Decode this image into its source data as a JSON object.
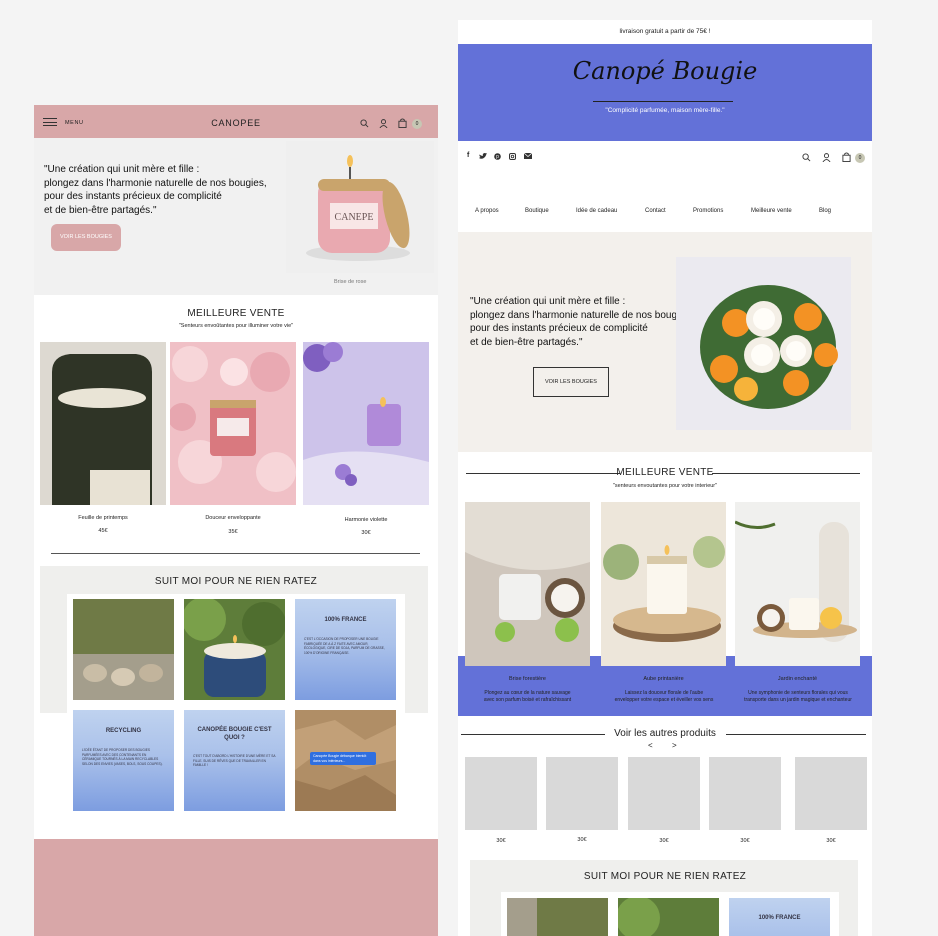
{
  "left": {
    "header": {
      "menu_label": "MENU",
      "brand": "CANOPEE",
      "cart_count": "0"
    },
    "hero": {
      "quote_lines": [
        "\"Une création qui unit mère et fille :",
        "plongez dans l'harmonie naturelle de nos bougies,",
        "pour des instants précieux de complicité",
        "et de bien-être partagés.\""
      ],
      "cta": "VOIR LES BOUGIES",
      "product_caption": "Brise de rose",
      "jar_label": "CANEPE"
    },
    "best": {
      "title": "MEILLEURE VENTE",
      "subtitle": "\"Senteurs envoûtantes pour illuminer votre vie\"",
      "products": [
        {
          "name": "Feuille de printemps",
          "price": "45€"
        },
        {
          "name": "Douceur enveloppante",
          "price": "35€"
        },
        {
          "name": "Harmonie violette",
          "price": "30€"
        }
      ]
    },
    "follow": {
      "title": "SUIT MOI POUR NE RIEN RATEZ",
      "cards": [
        {
          "title": "100% FRANCE",
          "body": "C'EST L'OCCASION DE PROPOSER UNE BOUGIE FABRIQUÉE DE A À Z FAITE AVEC AMOUR, ÉCOLOGIQUE, CIRE DE SOJA, PARFUM DE GRASSE, 100% D'ORIGINE FRANÇAISE."
        },
        {
          "title": "RECYCLING",
          "body": "L'IDÉE ÉTANT DE PROPOSER DES BOUGIES PARFUMÉES AVEC DES CONTENANTS EN CÉRAMIQUE TOURNÉS À LA MAIN RECYCLABLES SELON DES ENVIES (VASES, BOLS, SOUS COUPES)."
        },
        {
          "title": "CANOPÉE BOUGIE C'EST QUOI ?",
          "body": "C'EST TOUT D'ABORD L'HISTOIRE D'UNE MÈRE ET SA FILLE. SUIS DE RÊVES QUE DE TRAVAILLER EN FAMILLE !"
        }
      ],
      "message_bubble": "Canopée Bougie débarque bientôt dans vos intérieurs..."
    }
  },
  "right": {
    "topbar": "livraison gratuit a partir de 75€ !",
    "brand_script": "Canopé Bougie",
    "tagline": "\"Complicité parfumée, maison mère-fille.\"",
    "cart_count": "0",
    "nav": [
      "A propos",
      "Boutique",
      "Idée de cadeau",
      "Contact",
      "Promotions",
      "Meilleure vente",
      "Blog"
    ],
    "hero": {
      "quote_lines": [
        "\"Une création qui unit mère et fille :",
        "plongez dans l'harmonie naturelle de nos bougies,",
        "pour des instants précieux de complicité",
        "et de bien-être partagés.\""
      ],
      "cta": "VOIR LES BOUGIES"
    },
    "best": {
      "title": "MEILLEURE VENTE",
      "subtitle": "\"senteurs envoutantes pour votre interieur\"",
      "products": [
        {
          "name": "Brise forestière",
          "desc1": "Plongez au cœur de la nature sauvage",
          "desc2": "avec son parfum boisé et rafraîchissant"
        },
        {
          "name": "Aube printanière",
          "desc1": "Laissez la douceur florale de l'aube",
          "desc2": "envelopper votre espace et éveiller vos sens"
        },
        {
          "name": "Jardin enchanté",
          "desc1": "Une symphonie de senteurs florales qui vous",
          "desc2": "transporte dans un jardin magique et enchanteur"
        }
      ]
    },
    "others": {
      "title": "Voir les autres produits",
      "prev": "<",
      "next": ">",
      "prices": [
        "30€",
        "30€",
        "30€",
        "30€",
        "30€"
      ]
    },
    "follow": {
      "title": "SUIT MOI POUR NE RIEN RATEZ",
      "card_title": "100% FRANCE"
    }
  },
  "colors": {
    "pink": "#d8a7a8",
    "blue": "#6371d8",
    "cream": "#f3f0ec",
    "gray_panel": "#efefed",
    "placeholder": "#d9d9d9"
  }
}
